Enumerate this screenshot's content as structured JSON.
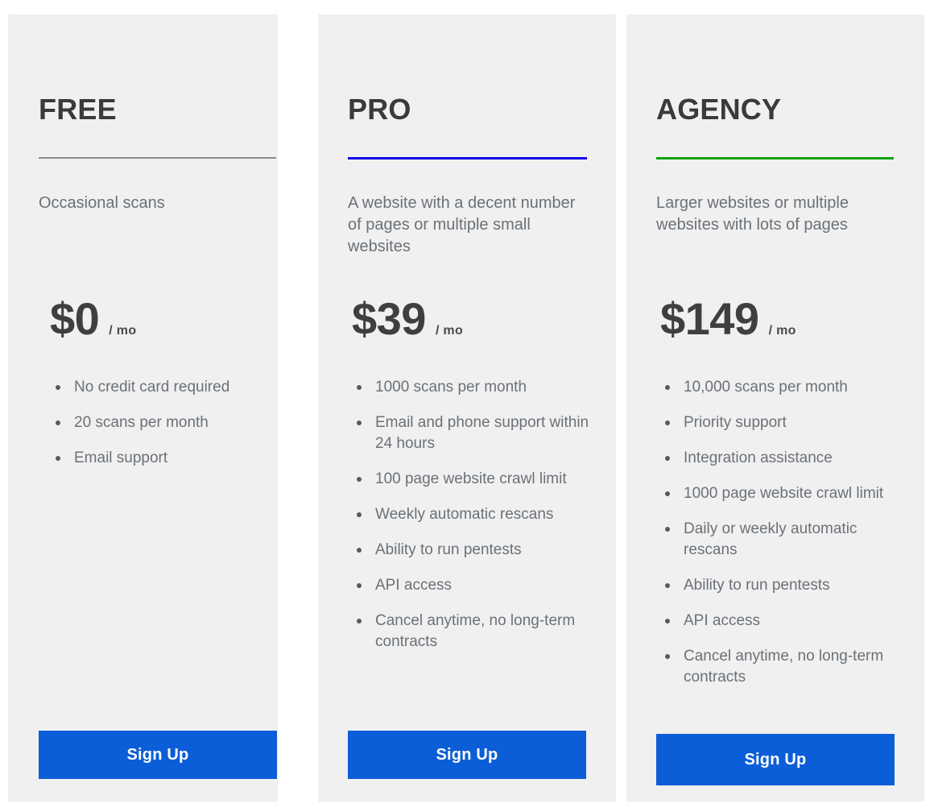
{
  "colors": {
    "page_background": "#ffffff",
    "card_background": "#f0f0f0",
    "title_text": "#3a3a3a",
    "body_text": "#6b7178",
    "price_text": "#3f3f3f",
    "button_background": "#0b5ed7",
    "button_text": "#ffffff",
    "accent_free": "#8c8c8c",
    "accent_pro": "#1200e8",
    "accent_agency": "#0ba40b"
  },
  "plans": [
    {
      "id": "free",
      "title": "FREE",
      "accent_color": "#8c8c8c",
      "description": "Occasional scans",
      "price": "$0",
      "period": "/ mo",
      "features": [
        "No credit card required",
        "20 scans per month",
        "Email support"
      ],
      "cta_label": "Sign Up"
    },
    {
      "id": "pro",
      "title": "PRO",
      "accent_color": "#1200e8",
      "description": "A website with a decent number of pages or multiple small websites",
      "price": "$39",
      "period": "/ mo",
      "features": [
        "1000 scans per month",
        "Email and phone support within 24 hours",
        "100 page website crawl limit",
        "Weekly automatic rescans",
        "Ability to run pentests",
        "API access",
        "Cancel anytime, no long-term contracts"
      ],
      "cta_label": "Sign Up"
    },
    {
      "id": "agency",
      "title": "AGENCY",
      "accent_color": "#0ba40b",
      "description": "Larger websites or multiple websites with lots of pages",
      "price": "$149",
      "period": "/ mo",
      "features": [
        "10,000 scans per month",
        "Priority support",
        "Integration assistance",
        "1000 page website crawl limit",
        "Daily or weekly automatic rescans",
        "Ability to run pentests",
        "API access",
        "Cancel anytime, no long-term contracts"
      ],
      "cta_label": "Sign Up"
    }
  ]
}
